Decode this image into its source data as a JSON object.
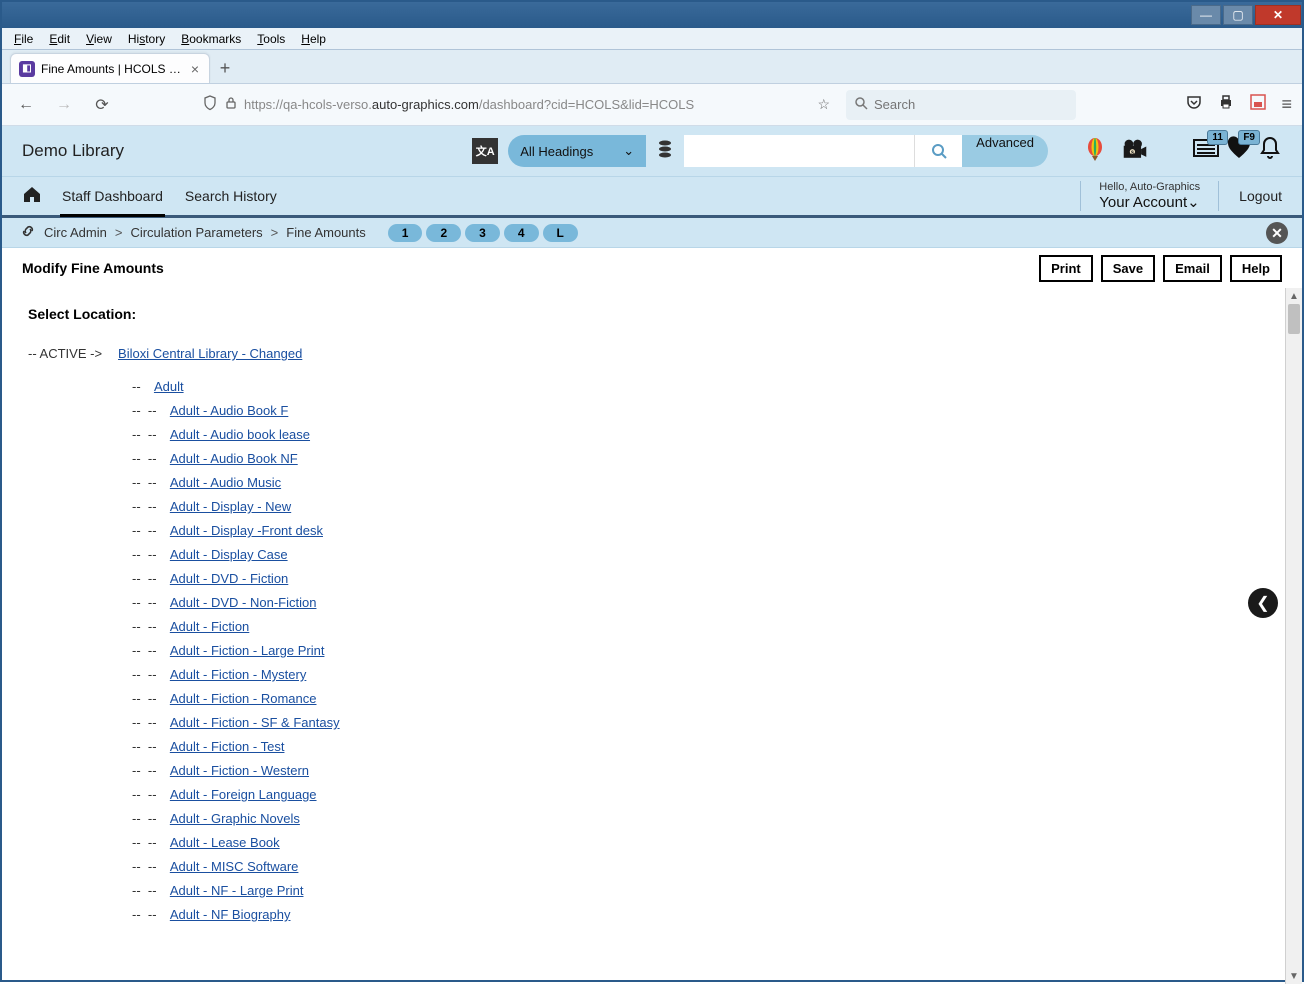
{
  "browser": {
    "menus": [
      "File",
      "Edit",
      "View",
      "History",
      "Bookmarks",
      "Tools",
      "Help"
    ],
    "tab_title": "Fine Amounts | HCOLS | hcols |",
    "url_prefix": "https://qa-hcols-verso.",
    "url_strong": "auto-graphics.com",
    "url_suffix": "/dashboard?cid=HCOLS&lid=HCOLS",
    "search_placeholder": "Search"
  },
  "app": {
    "title": "Demo Library",
    "dropdown": "All Headings",
    "advanced": "Advanced",
    "badge_card": "11",
    "badge_heart": "F9",
    "hello": "Hello, Auto-Graphics",
    "account": "Your Account",
    "logout": "Logout",
    "tabs": {
      "staff": "Staff Dashboard",
      "history": "Search History"
    }
  },
  "crumbs": {
    "a": "Circ Admin",
    "b": "Circulation Parameters",
    "c": "Fine Amounts",
    "pages": [
      "1",
      "2",
      "3",
      "4",
      "L"
    ]
  },
  "page": {
    "title": "Modify Fine Amounts",
    "buttons": {
      "print": "Print",
      "save": "Save",
      "email": "Email",
      "help": "Help"
    },
    "select_location": "Select Location:",
    "active_marker": "-- ACTIVE ->",
    "root_link": "Biloxi Central Library - Changed",
    "adult_link": "Adult",
    "items": [
      "Adult - Audio Book F",
      "Adult - Audio book lease",
      "Adult - Audio Book NF",
      "Adult - Audio Music",
      "Adult - Display - New",
      "Adult - Display -Front desk",
      "Adult - Display Case",
      "Adult - DVD - Fiction",
      "Adult - DVD - Non-Fiction",
      "Adult - Fiction",
      "Adult - Fiction - Large Print",
      "Adult - Fiction - Mystery",
      "Adult - Fiction - Romance",
      "Adult - Fiction - SF & Fantasy",
      "Adult - Fiction - Test",
      "Adult - Fiction - Western",
      "Adult - Foreign Language",
      "Adult - Graphic Novels",
      "Adult - Lease Book",
      "Adult - MISC Software",
      "Adult - NF - Large Print",
      "Adult - NF Biography"
    ]
  }
}
